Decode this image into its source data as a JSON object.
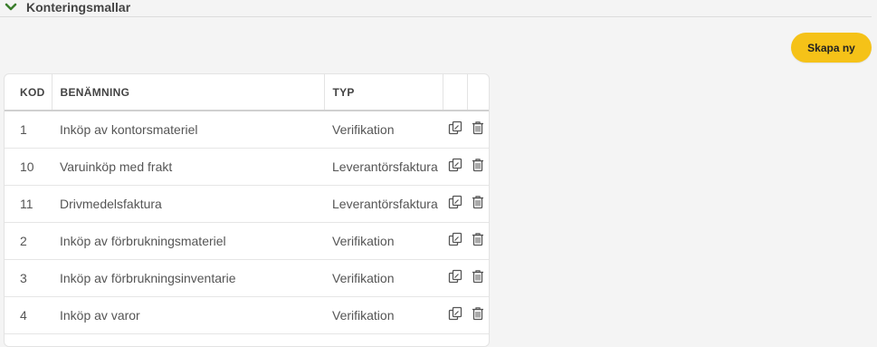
{
  "section": {
    "title": "Konteringsmallar",
    "icon": "chevron-down-icon",
    "accent_color": "#3a7d2c"
  },
  "actions": {
    "create_label": "Skapa ny",
    "create_color": "#f5c218"
  },
  "table": {
    "headers": {
      "code": "KOD",
      "name": "BENÄMNING",
      "type": "TYP"
    },
    "rows": [
      {
        "code": "1",
        "name": "Inköp av kontorsmateriel",
        "type": "Verifikation"
      },
      {
        "code": "10",
        "name": "Varuinköp med frakt",
        "type": "Leverantörsfaktura"
      },
      {
        "code": "11",
        "name": "Drivmedelsfaktura",
        "type": "Leverantörsfaktura"
      },
      {
        "code": "2",
        "name": "Inköp av förbrukningsmateriel",
        "type": "Verifikation"
      },
      {
        "code": "3",
        "name": "Inköp av förbrukningsinventarie",
        "type": "Verifikation"
      },
      {
        "code": "4",
        "name": "Inköp av varor",
        "type": "Verifikation"
      }
    ],
    "row_icons": [
      "copy-icon",
      "trash-icon"
    ]
  }
}
